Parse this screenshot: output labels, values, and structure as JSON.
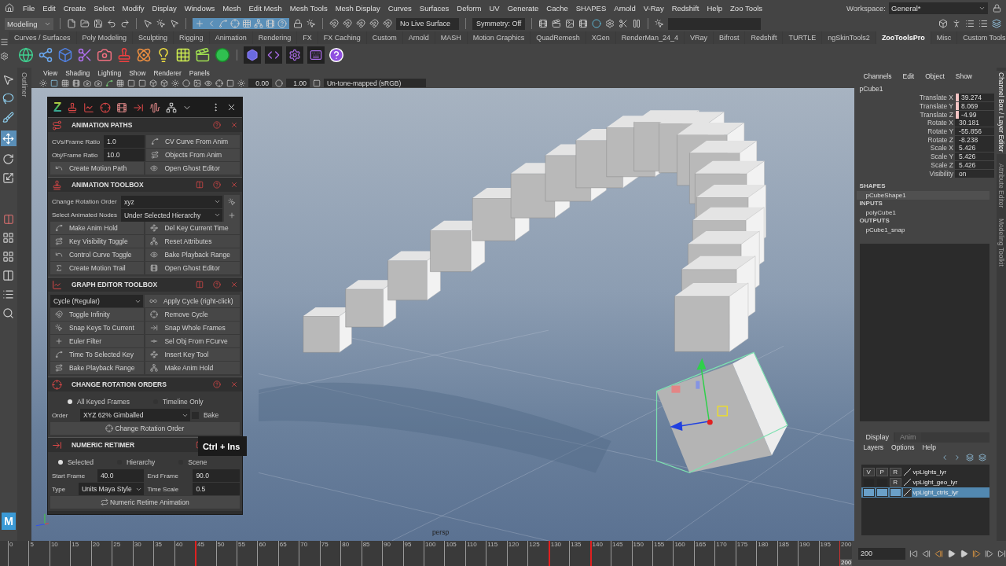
{
  "menu_bar": {
    "items": [
      "File",
      "Edit",
      "Create",
      "Select",
      "Modify",
      "Display",
      "Windows",
      "Mesh",
      "Edit Mesh",
      "Mesh Tools",
      "Mesh Display",
      "Curves",
      "Surfaces",
      "Deform",
      "UV",
      "Generate",
      "Cache",
      "SHAPES",
      "Arnold",
      "V-Ray",
      "Redshift",
      "Help",
      "Zoo Tools"
    ],
    "workspace_label": "Workspace:",
    "workspace": "General*"
  },
  "status_line": {
    "mode": "Modeling",
    "live_surface": "No Live Surface",
    "symmetry": "Symmetry: Off"
  },
  "shelf": {
    "tabs": [
      {
        "label": "Curves / Surfaces",
        "selected": false
      },
      {
        "label": "Poly Modeling",
        "selected": false
      },
      {
        "label": "Sculpting",
        "selected": false
      },
      {
        "label": "Rigging",
        "selected": false
      },
      {
        "label": "Animation",
        "selected": false
      },
      {
        "label": "Rendering",
        "selected": false
      },
      {
        "label": "FX",
        "selected": false
      },
      {
        "label": "FX Caching",
        "selected": false
      },
      {
        "label": "Custom",
        "selected": false
      },
      {
        "label": "Arnold",
        "selected": false
      },
      {
        "label": "MASH",
        "selected": false
      },
      {
        "label": "Motion Graphics",
        "selected": false
      },
      {
        "label": "QuadRemesh",
        "selected": false
      },
      {
        "label": "XGen",
        "selected": false
      },
      {
        "label": "RenderMan_24_4",
        "selected": false
      },
      {
        "label": "VRay",
        "selected": false
      },
      {
        "label": "Bifrost",
        "selected": false
      },
      {
        "label": "Redshift",
        "selected": false
      },
      {
        "label": "TURTLE",
        "selected": false
      },
      {
        "label": "ngSkinTools2",
        "selected": false
      },
      {
        "label": "ZooToolsPro",
        "selected": true
      },
      {
        "label": "Misc",
        "selected": false
      },
      {
        "label": "Custom Tools",
        "selected": false
      }
    ]
  },
  "outliner_tab": "Outliner",
  "maya_logo": "M",
  "viewport": {
    "menus": [
      "View",
      "Shading",
      "Lighting",
      "Show",
      "Renderer",
      "Panels"
    ],
    "exposure": "0.00",
    "gamma": "1.00",
    "color_space": "Un-tone-mapped (sRGB)",
    "camera": "persp",
    "tooltip": "Ctrl + Ins"
  },
  "zoo_panel": {
    "logo": "Z",
    "sections": [
      {
        "title": "ANIMATION PATHS",
        "stack_icon": false,
        "rows": [
          {
            "kind": "field_button",
            "label": "CVs/Frame Ratio",
            "value": "1.0",
            "button": "CV Curve From Anim"
          },
          {
            "kind": "field_button",
            "label": "Obj/Frame Ratio",
            "value": "10.0",
            "button": "Objects From Anim"
          },
          {
            "kind": "buttons",
            "buttons": [
              "Create Motion Path",
              "Open Ghost Editor"
            ]
          }
        ]
      },
      {
        "title": "ANIMATION TOOLBOX",
        "stack_icon": true,
        "rows": [
          {
            "kind": "select_icon",
            "label": "Change Rotation Order",
            "value": "xyz"
          },
          {
            "kind": "select_icon",
            "label": "Select Animated Nodes",
            "value": "Under Selected Hierarchy"
          },
          {
            "kind": "buttons",
            "buttons": [
              "Make Anim Hold",
              "Del Key Current Time"
            ]
          },
          {
            "kind": "buttons",
            "buttons": [
              "Key Visibility Toggle",
              "Reset Attributes"
            ]
          },
          {
            "kind": "buttons",
            "buttons": [
              "Control Curve Toggle",
              "Bake Playback Range"
            ]
          },
          {
            "kind": "buttons",
            "buttons": [
              "Create Motion Trail",
              "Open Ghost Editor"
            ]
          }
        ]
      },
      {
        "title": "GRAPH EDITOR TOOLBOX",
        "stack_icon": true,
        "rows": [
          {
            "kind": "dropdown_button",
            "value": "Cycle (Regular)",
            "button": "Apply Cycle (right-click)"
          },
          {
            "kind": "buttons",
            "buttons": [
              "Toggle Infinity",
              "Remove Cycle"
            ]
          },
          {
            "kind": "buttons",
            "buttons": [
              "Snap Keys To Current",
              "Snap Whole Frames"
            ]
          },
          {
            "kind": "buttons",
            "buttons": [
              "Euler Filter",
              "Sel Obj From FCurve"
            ]
          },
          {
            "kind": "buttons",
            "buttons": [
              "Time To Selected Key",
              "Insert Key Tool"
            ]
          },
          {
            "kind": "buttons",
            "buttons": [
              "Bake Playback Range",
              "Make Anim Hold"
            ]
          }
        ]
      },
      {
        "title": "CHANGE ROTATION ORDERS",
        "stack_icon": false,
        "rows": [
          {
            "kind": "radios",
            "options": [
              {
                "label": "All Keyed Frames",
                "selected": true
              },
              {
                "label": "Timeline Only",
                "selected": false
              }
            ]
          },
          {
            "kind": "order",
            "label": "Order",
            "value": "XYZ 62% Gimballed",
            "checkbox": {
              "label": "Bake",
              "checked": false
            }
          },
          {
            "kind": "wide_button",
            "label": "Change Rotation Order"
          }
        ]
      },
      {
        "title": "NUMERIC RETIMER",
        "stack_icon": true,
        "rows": [
          {
            "kind": "radios",
            "options": [
              {
                "label": "Selected",
                "selected": true
              },
              {
                "label": "Hierarchy",
                "selected": false
              },
              {
                "label": "Scene",
                "selected": false
              }
            ]
          },
          {
            "kind": "pairs",
            "items": [
              {
                "label": "Start Frame",
                "value": "40.0",
                "kind": "field"
              },
              {
                "label": "End Frame",
                "value": "90.0",
                "kind": "field"
              }
            ]
          },
          {
            "kind": "pairs",
            "items": [
              {
                "label": "Type",
                "value": "Units Maya Style",
                "kind": "dropdown"
              },
              {
                "label": "Time Scale",
                "value": "0.5",
                "kind": "field"
              }
            ]
          },
          {
            "kind": "wide_button",
            "label": "Numeric Retime Animation"
          }
        ]
      }
    ]
  },
  "channel_box": {
    "menus": [
      "Channels",
      "Edit",
      "Object",
      "Show"
    ],
    "object": "pCube1",
    "channels": [
      {
        "name": "Translate X",
        "value": "39.274",
        "keyed": true
      },
      {
        "name": "Translate Y",
        "value": "8.069",
        "keyed": true
      },
      {
        "name": "Translate Z",
        "value": "-4.99",
        "keyed": true
      },
      {
        "name": "Rotate X",
        "value": "30.181",
        "keyed": false
      },
      {
        "name": "Rotate Y",
        "value": "-55.856",
        "keyed": false
      },
      {
        "name": "Rotate Z",
        "value": "-8.238",
        "keyed": false
      },
      {
        "name": "Scale X",
        "value": "5.426",
        "keyed": false
      },
      {
        "name": "Scale Y",
        "value": "5.426",
        "keyed": false
      },
      {
        "name": "Scale Z",
        "value": "5.426",
        "keyed": false
      },
      {
        "name": "Visibility",
        "value": "on",
        "keyed": false
      }
    ],
    "groups": [
      {
        "heading": "SHAPES",
        "items": [
          {
            "name": "pCubeShape1",
            "selected": true
          }
        ]
      },
      {
        "heading": "INPUTS",
        "items": [
          {
            "name": "polyCube1",
            "selected": false
          }
        ]
      },
      {
        "heading": "OUTPUTS",
        "items": [
          {
            "name": "pCube1_snap",
            "selected": false
          }
        ]
      }
    ]
  },
  "layer_editor": {
    "tabs": [
      {
        "label": "Display",
        "selected": true
      },
      {
        "label": "Anim",
        "selected": false
      }
    ],
    "menus": [
      "Layers",
      "Options",
      "Help"
    ],
    "layers": [
      {
        "name": "vpLights_lyr",
        "selected": false,
        "flags": [
          {
            "label": "V",
            "on": true
          },
          {
            "label": "P",
            "on": true
          },
          {
            "label": "R",
            "on": true
          }
        ]
      },
      {
        "name": "vpLight_geo_lyr",
        "selected": false,
        "flags": [
          {
            "on": false
          },
          {
            "on": false
          },
          {
            "label": "R",
            "on": true
          }
        ]
      },
      {
        "name": "vpLight_ctrls_lyr",
        "selected": true,
        "flags": [
          {
            "on": false
          },
          {
            "on": false
          },
          {
            "on": false
          }
        ]
      }
    ]
  },
  "side_tabs": [
    {
      "label": "Channel Box / Layer Editor",
      "selected": true
    },
    {
      "label": "Attribute Editor",
      "selected": false
    },
    {
      "label": "Modeling Toolkit",
      "selected": false
    }
  ],
  "timeline": {
    "ticks": [
      {
        "label": "0",
        "key": false
      },
      {
        "label": "5",
        "key": false
      },
      {
        "label": "10",
        "key": false
      },
      {
        "label": "15",
        "key": false
      },
      {
        "label": "20",
        "key": false
      },
      {
        "label": "25",
        "key": false
      },
      {
        "label": "30",
        "key": false
      },
      {
        "label": "35",
        "key": false
      },
      {
        "label": "40",
        "key": false
      },
      {
        "label": "45",
        "key": true
      },
      {
        "label": "50",
        "key": false
      },
      {
        "label": "55",
        "key": false
      },
      {
        "label": "60",
        "key": false
      },
      {
        "label": "65",
        "key": false
      },
      {
        "label": "70",
        "key": false
      },
      {
        "label": "75",
        "key": false
      },
      {
        "label": "80",
        "key": false
      },
      {
        "label": "85",
        "key": false
      },
      {
        "label": "90",
        "key": false
      },
      {
        "label": "95",
        "key": false
      },
      {
        "label": "100",
        "key": false
      },
      {
        "label": "105",
        "key": false
      },
      {
        "label": "110",
        "key": false
      },
      {
        "label": "115",
        "key": false
      },
      {
        "label": "120",
        "key": false
      },
      {
        "label": "125",
        "key": false
      },
      {
        "label": "130",
        "key": true
      },
      {
        "label": "135",
        "key": false
      },
      {
        "label": "140",
        "key": true
      },
      {
        "label": "145",
        "key": false
      },
      {
        "label": "150",
        "key": false
      },
      {
        "label": "155",
        "key": false
      },
      {
        "label": "160",
        "key": false
      },
      {
        "label": "165",
        "key": false
      },
      {
        "label": "170",
        "key": false
      },
      {
        "label": "175",
        "key": false
      },
      {
        "label": "180",
        "key": false
      },
      {
        "label": "185",
        "key": false
      },
      {
        "label": "190",
        "key": false
      },
      {
        "label": "195",
        "key": false
      }
    ],
    "end_label": "200",
    "current_frame": "200",
    "range_field": "200"
  }
}
